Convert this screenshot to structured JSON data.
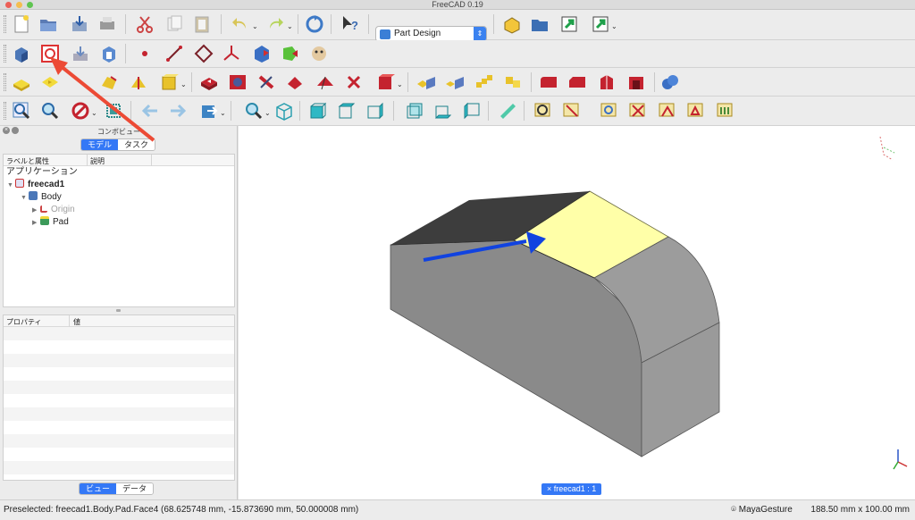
{
  "window": {
    "title": "FreeCAD 0.19"
  },
  "toolbar": {
    "workbench": "Part Design",
    "icons_row1": [
      "new-document-icon",
      "open-document-icon",
      "save-document-icon",
      "print-icon",
      "cut-icon",
      "copy-icon",
      "paste-icon",
      "undo-icon",
      "redo-icon",
      "refresh-icon",
      "whats-this-icon"
    ],
    "icons_row1_right": [
      "part-icon",
      "group-icon",
      "link-icon",
      "link-actions-icon"
    ],
    "icons_row2": [
      "create-body-icon",
      "create-sketch-icon",
      "validate-sketch-icon",
      "clone-icon",
      "datum-point-icon",
      "datum-line-icon",
      "datum-plane-icon",
      "local-coordinate-system-icon",
      "shape-binder-icon",
      "subshape-binder-icon",
      "sprocket-icon"
    ],
    "icons_row3": [
      "pad-icon",
      "pocket-icon",
      "revolution-icon",
      "groove-icon",
      "additive-loft-icon",
      "additive-pipe-icon",
      "additive-helix-icon",
      "subtractive-loft-icon",
      "subtractive-pipe-icon",
      "subtractive-helix-icon",
      "subtractive-primitive-icon",
      "mirrored-icon",
      "linear-pattern-icon",
      "polar-pattern-icon",
      "multitransform-icon",
      "fillet-icon",
      "chamfer-icon",
      "draft-icon",
      "thickness-icon",
      "boolean-icon"
    ],
    "icons_row4": [
      "fit-all-icon",
      "fit-selection-icon",
      "draw-style-icon",
      "bounding-box-icon",
      "back-icon",
      "forward-icon",
      "sync-view-icon",
      "std-view-box-zoom-icon",
      "isometric-view-icon",
      "front-view-icon",
      "top-view-icon",
      "right-view-icon",
      "rear-view-icon",
      "bottom-view-icon",
      "left-view-icon",
      "measure-distance-icon",
      "measure-linear-icon",
      "measure-angular-icon",
      "measure-refresh-icon",
      "measure-clear-icon",
      "measure-toggle-3d-icon",
      "measure-toggle-delta-icon",
      "measure-all-icon"
    ]
  },
  "combo_view": {
    "title": "コンボビュー",
    "tabs": [
      {
        "label": "モデル",
        "active": true
      },
      {
        "label": "タスク",
        "active": false
      }
    ],
    "tree": {
      "columns": [
        "ラベルと属性",
        "説明"
      ],
      "root": "アプリケーション",
      "items": [
        {
          "label": "freecad1",
          "bold": true
        },
        {
          "label": "Body"
        },
        {
          "label": "Origin",
          "dim": true
        },
        {
          "label": "Pad"
        }
      ]
    },
    "properties": {
      "columns": [
        "プロパティ",
        "値"
      ]
    },
    "bottom_tabs": [
      {
        "label": "ビュー",
        "active": true
      },
      {
        "label": "データ",
        "active": false
      }
    ]
  },
  "view3d": {
    "document_tab": "× freecad1 : 1",
    "colors": {
      "face_top_dark": "#3d3d3d",
      "face_highlight": "#ffffa8",
      "face_side": "#8a8a8a",
      "face_front": "#9a9a9a",
      "arrow_blue": "#1143e0",
      "arrow_red": "#ec4a35"
    }
  },
  "statusbar": {
    "message": "Preselected: freecad1.Body.Pad.Face4 (68.625748 mm, -15.873690 mm, 50.000008 mm)",
    "navigation": "MayaGesture",
    "dimensions": "188.50 mm x 100.00 mm"
  }
}
